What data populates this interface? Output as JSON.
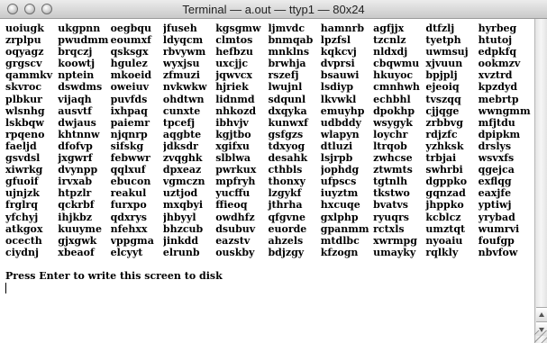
{
  "window": {
    "title": "Terminal — a.out — ttyp1 — 80x24"
  },
  "terminal": {
    "rows": [
      [
        "uoiugk",
        "ukgpnn",
        "oegbqu",
        "jfuseh",
        "kgsgmw",
        "ljmvdc",
        "hamnrb",
        "agfjjx",
        "dtfzlj",
        "hyrbeg"
      ],
      [
        "zrplpu",
        "pwudmm",
        "eoumxf",
        "ldyqcm",
        "clmtos",
        "bnmqab",
        "lpzfsl",
        "tzcnlz",
        "tyetph",
        "htutoj"
      ],
      [
        "oqyagz",
        "brqczj",
        "qsksgx",
        "rbvywm",
        "hefbzu",
        "mnklns",
        "kqkcvj",
        "nldxdj",
        "uwmsuj",
        "edpkfq"
      ],
      [
        "grgscv",
        "koowtj",
        "hgulez",
        "wyxjsu",
        "uxcjjc",
        "brwhja",
        "dvprsi",
        "cbqwmu",
        "xjvuun",
        "ookmzv"
      ],
      [
        "qammkv",
        "nptein",
        "mkoeid",
        "zfmuzi",
        "jqwvcx",
        "rszefj",
        "bsauwi",
        "hkuyoc",
        "bpjplj",
        "xvztrd"
      ],
      [
        "skvroc",
        "dswdms",
        "oweiuv",
        "nvkwkw",
        "hjriek",
        "lwujnl",
        "lsdiyp",
        "cmnhwh",
        "ejeoiq",
        "kpzdyd"
      ],
      [
        "plbkur",
        "vijaqh",
        "puvfds",
        "ohdtwn",
        "lidnmd",
        "sdqunl",
        "lkvwkl",
        "echbhl",
        "tvszqq",
        "mebrtp"
      ],
      [
        "wlsnhg",
        "ausvtf",
        "ixhpaq",
        "cunxte",
        "nhkozd",
        "dxqyka",
        "emuyhp",
        "dpokhp",
        "cjjqge",
        "wwngmm"
      ],
      [
        "lskbqw",
        "dwjaus",
        "paiemr",
        "tpcefj",
        "ibhvjv",
        "kunwxf",
        "udbddy",
        "wsygyk",
        "zrbbvg",
        "mfjtdu"
      ],
      [
        "rpqeno",
        "khtnnw",
        "njqnrp",
        "aqgbte",
        "kgjtbo",
        "gsfgzs",
        "wlapyn",
        "loychr",
        "rdjzfc",
        "dpipkm"
      ],
      [
        "faeljd",
        "dfofvp",
        "sifskg",
        "jdksdr",
        "xgifxu",
        "tdxyog",
        "dtluzi",
        "ltrqob",
        "yzhksk",
        "drslys"
      ],
      [
        "gsvdsl",
        "jxgwrf",
        "febwwr",
        "zvqghk",
        "slblwa",
        "desahk",
        "lsjrpb",
        "zwhcse",
        "trbjai",
        "wsvxfs"
      ],
      [
        "xiwrkg",
        "dvynpp",
        "qqlxuf",
        "dpxeaz",
        "pwrkux",
        "cthbls",
        "jophdg",
        "ztwmts",
        "swhrbi",
        "qgejca"
      ],
      [
        "gfuoif",
        "irvxab",
        "ebucon",
        "vgmczn",
        "mpfryh",
        "thonxy",
        "ufpscs",
        "tgtnlh",
        "dgppko",
        "exflqg"
      ],
      [
        "ujnjzk",
        "htpzlr",
        "reakul",
        "uztjod",
        "yucffu",
        "lzgykf",
        "iuyztm",
        "tkstwo",
        "gqnzad",
        "eaxjfe"
      ],
      [
        "frglrq",
        "qckrbf",
        "furxpo",
        "mxqbyi",
        "ffieoq",
        "jthrha",
        "hxcuqe",
        "bvatvs",
        "jhppko",
        "yptiwj"
      ],
      [
        "yfchyj",
        "ihjkbz",
        "qdxrys",
        "jhbyyl",
        "owdhfz",
        "qfgvne",
        "gxlphp",
        "ryuqrs",
        "kcblcz",
        "yrybad"
      ],
      [
        "atkgox",
        "kuuyme",
        "nfehxx",
        "bhzcub",
        "dsubuv",
        "euorde",
        "gpanmm",
        "rctxls",
        "umztqt",
        "wumrvi"
      ],
      [
        "ocecth",
        "gjxgwk",
        "vppgma",
        "jinkdd",
        "eazstv",
        "ahzels",
        "mtdlbc",
        "xwrmpg",
        "nyoaiu",
        "foufgp"
      ],
      [
        "ciydnj",
        "xbeaof",
        "elcyyt",
        "elrunb",
        "ouskby",
        "bdjzgy",
        "kfzogn",
        "umayky",
        "rqlkly",
        "nbvfow"
      ]
    ],
    "prompt": "Press Enter to write this screen to disk"
  }
}
